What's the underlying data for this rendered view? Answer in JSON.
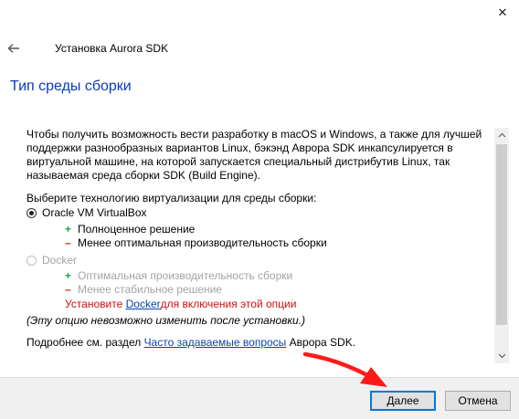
{
  "window": {
    "title": "Установка Aurora SDK",
    "close_glyph": "✕"
  },
  "page": {
    "heading": "Тип среды сборки",
    "intro": "Чтобы получить возможность вести разработку в macOS и Windows, а также для лучшей поддержки разнообразных вариантов Linux, бэкэнд Аврора SDK инкапсулируется в виртуальной машине, на которой запускается специальный дистрибутив Linux, так называемая среда сборки SDK (Build Engine).",
    "choose_label": "Выберите технологию виртуализации для среды сборки:",
    "options": [
      {
        "label": "Oracle VM VirtualBox",
        "selected": true,
        "enabled": true,
        "pros": [
          "Полноценное решение"
        ],
        "cons": [
          "Менее оптимальная производительность сборки"
        ]
      },
      {
        "label": "Docker",
        "selected": false,
        "enabled": false,
        "pros": [
          "Оптимальная производительность сборки"
        ],
        "cons": [
          "Менее стабильное решение"
        ]
      }
    ],
    "docker_warning": {
      "prefix": "Установите ",
      "link": "Docker",
      "suffix": "для включения этой опции"
    },
    "note": "(Эту опцию невозможно изменить после установки.)",
    "more": {
      "prefix": "Подробнее см. раздел ",
      "link": "Часто задаваемые вопросы",
      "suffix": " Аврора SDK."
    }
  },
  "buttons": {
    "next": "Далее",
    "cancel": "Отмена"
  },
  "colors": {
    "heading": "#0a3bbd",
    "plus": "#1aa34a",
    "minus": "#d81818",
    "warning": "#d30f0f",
    "link": "#0645ad",
    "annotation_arrow": "#ff1a1a"
  }
}
